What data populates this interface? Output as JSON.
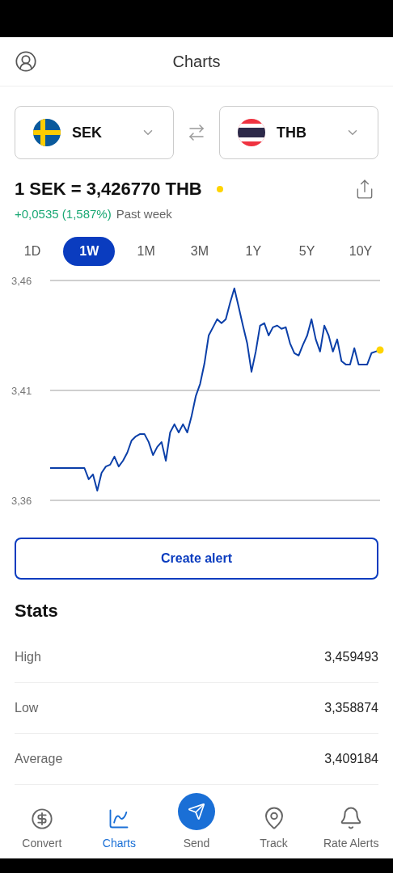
{
  "header": {
    "title": "Charts"
  },
  "pair": {
    "from": {
      "code": "SEK",
      "kind": "se"
    },
    "to": {
      "code": "THB",
      "kind": "th"
    }
  },
  "rate": {
    "text": "1 SEK = 3,426770 THB",
    "live": true,
    "change": "+0,0535 (1,587%)",
    "period": "Past week"
  },
  "ranges": [
    {
      "label": "1D",
      "selected": false
    },
    {
      "label": "1W",
      "selected": true
    },
    {
      "label": "1M",
      "selected": false
    },
    {
      "label": "3M",
      "selected": false
    },
    {
      "label": "1Y",
      "selected": false
    },
    {
      "label": "5Y",
      "selected": false
    },
    {
      "label": "10Y",
      "selected": false
    }
  ],
  "chart_data": {
    "type": "line",
    "ylim": [
      3.36,
      3.46
    ],
    "yticks": [
      {
        "value": 3.36,
        "label": "3,36"
      },
      {
        "value": 3.41,
        "label": "3,41"
      },
      {
        "value": 3.46,
        "label": "3,46"
      }
    ],
    "series": [
      {
        "color": "#0b3fa8",
        "values": [
          3.3747,
          3.3747,
          3.3747,
          3.3747,
          3.3747,
          3.3747,
          3.3747,
          3.3747,
          3.3747,
          3.3696,
          3.3718,
          3.3644,
          3.3725,
          3.3754,
          3.3762,
          3.3799,
          3.3754,
          3.378,
          3.3817,
          3.3872,
          3.3891,
          3.3902,
          3.3902,
          3.3865,
          3.3806,
          3.3843,
          3.3865,
          3.378,
          3.3909,
          3.3946,
          3.3909,
          3.3946,
          3.3909,
          3.3983,
          3.4075,
          3.413,
          3.4222,
          3.435,
          3.4387,
          3.4424,
          3.4406,
          3.4424,
          3.4498,
          3.4564,
          3.448,
          3.4395,
          3.4314,
          3.4185,
          3.4277,
          3.4395,
          3.4406,
          3.435,
          3.4387,
          3.4395,
          3.438,
          3.4387,
          3.4314,
          3.427,
          3.4259,
          3.4307,
          3.435,
          3.4424,
          3.4332,
          3.4277,
          3.4395,
          3.435,
          3.4277,
          3.4332,
          3.4233,
          3.4218,
          3.4218,
          3.4292,
          3.4218,
          3.4218,
          3.4218,
          3.427,
          3.4277,
          3.4284
        ]
      }
    ]
  },
  "alert_button": "Create alert",
  "stats": {
    "title": "Stats",
    "rows": [
      {
        "label": "High",
        "value": "3,459493"
      },
      {
        "label": "Low",
        "value": "3,358874"
      },
      {
        "label": "Average",
        "value": "3,409184"
      }
    ]
  },
  "nav": [
    {
      "label": "Convert",
      "kind": "coins",
      "selected": false
    },
    {
      "label": "Charts",
      "kind": "chart",
      "selected": true
    },
    {
      "label": "Send",
      "kind": "send",
      "selected": false
    },
    {
      "label": "Track",
      "kind": "pin",
      "selected": false
    },
    {
      "label": "Rate Alerts",
      "kind": "bell",
      "selected": false
    }
  ]
}
